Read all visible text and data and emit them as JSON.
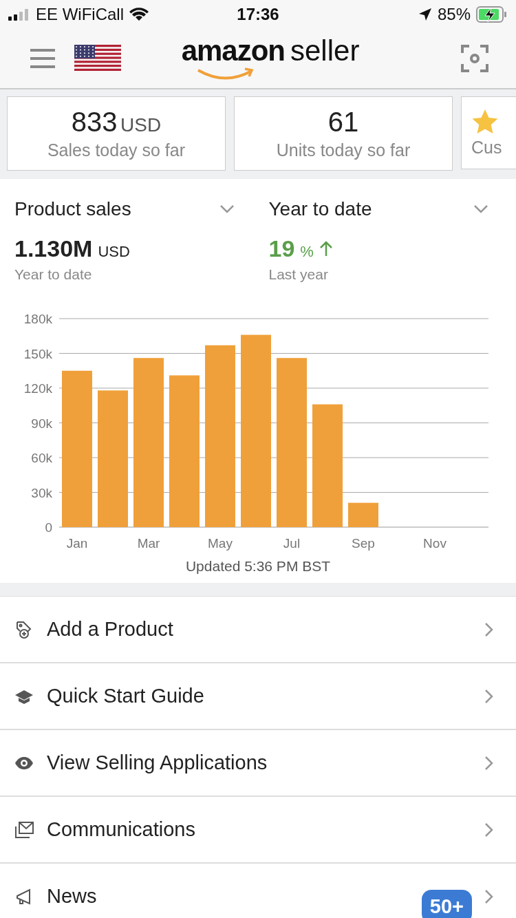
{
  "status_bar": {
    "carrier": "EE WiFiCall",
    "time": "17:36",
    "battery": "85%"
  },
  "header": {
    "logo_brand": "amazon",
    "logo_product": "seller"
  },
  "cards": [
    {
      "kind": "value",
      "value": "833",
      "unit": "USD",
      "label": "Sales today so far"
    },
    {
      "kind": "value",
      "value": "61",
      "label": "Units today so far"
    },
    {
      "kind": "rating",
      "label": "Cus"
    }
  ],
  "metrics": [
    {
      "selector": "Product sales",
      "value": "1.130M",
      "unit": "USD",
      "caption": "Year to date",
      "rising": false
    },
    {
      "selector": "Year to date",
      "value": "19",
      "unit": "%",
      "caption": "Last year",
      "rising": true
    }
  ],
  "chart_data": {
    "type": "bar",
    "categories": [
      "Jan",
      null,
      "Mar",
      null,
      "May",
      null,
      "Jul",
      null,
      "Sep",
      null,
      "Nov",
      null
    ],
    "values": [
      135000,
      118000,
      146000,
      131000,
      157000,
      166000,
      146000,
      106000,
      21000,
      null,
      null,
      null
    ],
    "grid": true,
    "ylim": [
      0,
      180000
    ],
    "yticks": [
      {
        "value": 0,
        "label": "0"
      },
      {
        "value": 30000,
        "label": "30k"
      },
      {
        "value": 60000,
        "label": "60k"
      },
      {
        "value": 90000,
        "label": "90k"
      },
      {
        "value": 120000,
        "label": "120k"
      },
      {
        "value": 150000,
        "label": "150k"
      },
      {
        "value": 180000,
        "label": "180k"
      }
    ]
  },
  "updated": "Updated 5:36 PM BST",
  "menu": [
    {
      "label": "Add a Product"
    },
    {
      "label": "Quick Start Guide"
    },
    {
      "label": "View Selling Applications"
    },
    {
      "label": "Communications"
    },
    {
      "label": "News",
      "badge": "50+"
    }
  ]
}
